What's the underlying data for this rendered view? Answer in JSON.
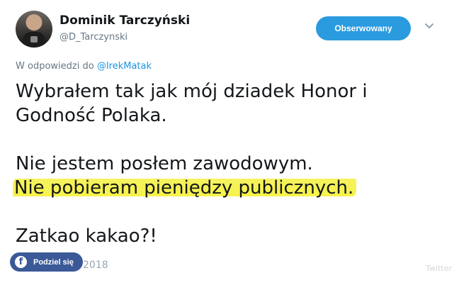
{
  "author": {
    "display_name": "Dominik Tarczyński",
    "handle": "@D_Tarczynski",
    "avatar_icon": "profile-photo"
  },
  "follow_button": {
    "label": "Obserwowany",
    "color": "#2b9bdf"
  },
  "menu_icon": "chevron-down-icon",
  "reply": {
    "prefix": "W odpowiedzi do ",
    "mention": "@IrekMatak",
    "mention_color": "#1b95e0"
  },
  "tweet": {
    "lines": [
      "Wybrałem tak jak mój dziadek Honor i",
      "Godność Polaka.",
      "Nie jestem posłem zawodowym.",
      "Nie pobieram pieniędzy publicznych.",
      "Zatkao kakao?!"
    ],
    "highlight_color": "#f7f34a"
  },
  "share": {
    "label": "Podziel się",
    "icon": "facebook-icon",
    "color": "#3b5998"
  },
  "date": "2018",
  "watermark": "Twitter"
}
